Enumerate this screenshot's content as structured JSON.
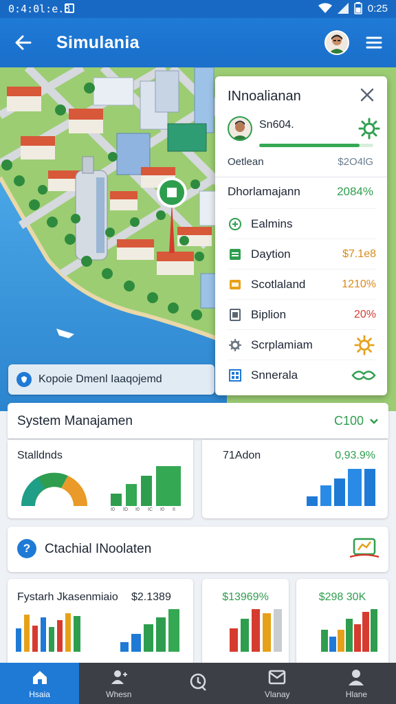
{
  "statusbar": {
    "time_left": "0:4:0l:e.8",
    "time_right": "0:25"
  },
  "appbar": {
    "title": "Simulania"
  },
  "map": {
    "chip_text": "Kopoie Dmenl Iaaqojemd"
  },
  "panel": {
    "title": "INnoalianan",
    "user_name": "Sn604.",
    "user_progress": 0.88,
    "summary_label": "Oetlean",
    "summary_value": "$2O4lG",
    "highlight_label": "Dhorlamajann",
    "highlight_value": "2084%",
    "rows": [
      {
        "label": "Ealmins",
        "value": "",
        "icon": "plus-circle-icon",
        "color": "#2e9e4e"
      },
      {
        "label": "Daytion",
        "value": "$7.1e8",
        "icon": "list-icon",
        "color": "#d98a1a"
      },
      {
        "label": "Scotlaland",
        "value": "1210%",
        "icon": "card-icon",
        "color": "#d98a1a"
      },
      {
        "label": "Biplion",
        "value": "20%",
        "icon": "doc-icon",
        "color": "#d63b2f"
      },
      {
        "label": "Scrplamiam",
        "value": "",
        "icon": "gear-icon",
        "color": "#e6a11b"
      },
      {
        "label": "Snnerala",
        "value": "",
        "icon": "grid-icon",
        "color": "#2e9e4e"
      }
    ]
  },
  "system": {
    "title": "System Manajamen",
    "value": "C100"
  },
  "card1": {
    "label": "Stalldnds",
    "bar_labels": [
      "I0",
      "ID",
      "I0",
      "IC",
      "I0",
      "II"
    ]
  },
  "card2": {
    "label": "71Adon",
    "value": "0,93.9%"
  },
  "notice": {
    "text": "Ctachial INoolaten"
  },
  "bottom1": {
    "label": "Fystarh Jkasenmiaio",
    "value": "$2.1389"
  },
  "bottom2": {
    "value": "$13969%"
  },
  "bottom3": {
    "value": "$298 30K"
  },
  "nav": [
    {
      "label": "Hsaia",
      "icon": "home-icon"
    },
    {
      "label": "Whesn",
      "icon": "user-plus-icon"
    },
    {
      "label": "",
      "icon": "search-icon"
    },
    {
      "label": "Vlanay",
      "icon": "inbox-icon"
    },
    {
      "label": "Hlane",
      "icon": "profile-icon"
    }
  ],
  "colors": {
    "primary": "#1f7ad6",
    "green": "#2e9e4e",
    "orange": "#d98a1a",
    "red": "#d63b2f"
  }
}
